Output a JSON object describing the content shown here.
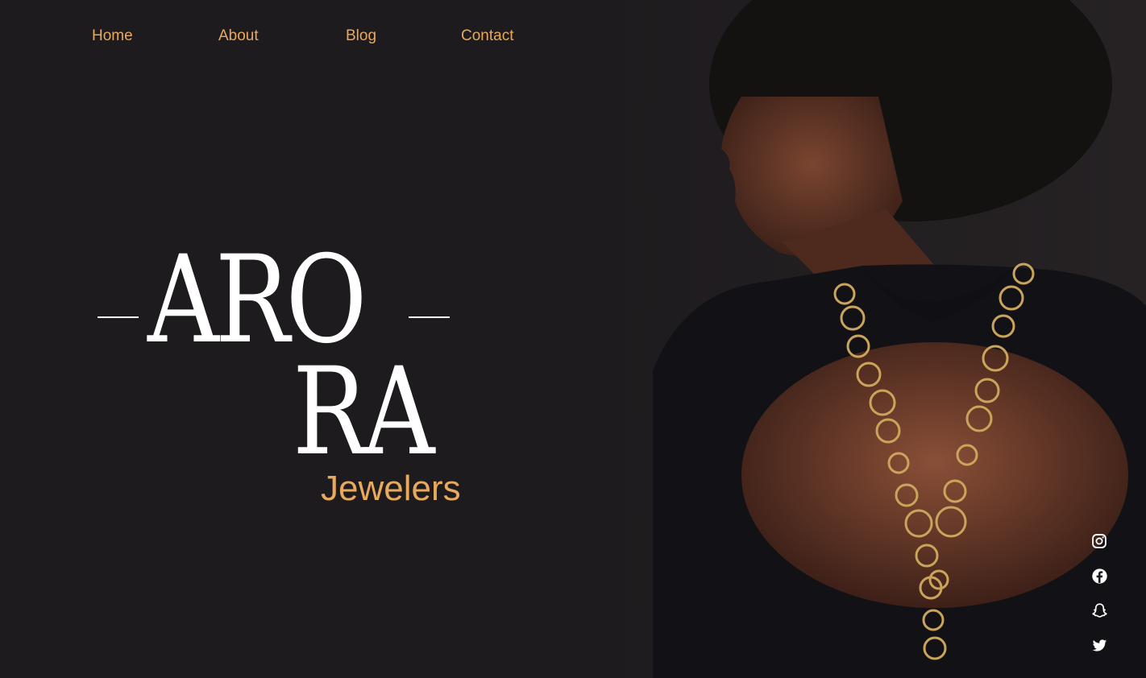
{
  "nav": {
    "items": [
      {
        "label": "Home"
      },
      {
        "label": "About"
      },
      {
        "label": "Blog"
      },
      {
        "label": "Contact"
      }
    ]
  },
  "logo": {
    "line1": "ARO",
    "line2": "RA",
    "subtitle": "Jewelers"
  },
  "social": {
    "icons": [
      "instagram-icon",
      "facebook-icon",
      "snapchat-icon",
      "twitter-icon"
    ]
  },
  "colors": {
    "background": "#1e1b1e",
    "accent": "#e8a95c",
    "logo_text": "#ffffff"
  }
}
